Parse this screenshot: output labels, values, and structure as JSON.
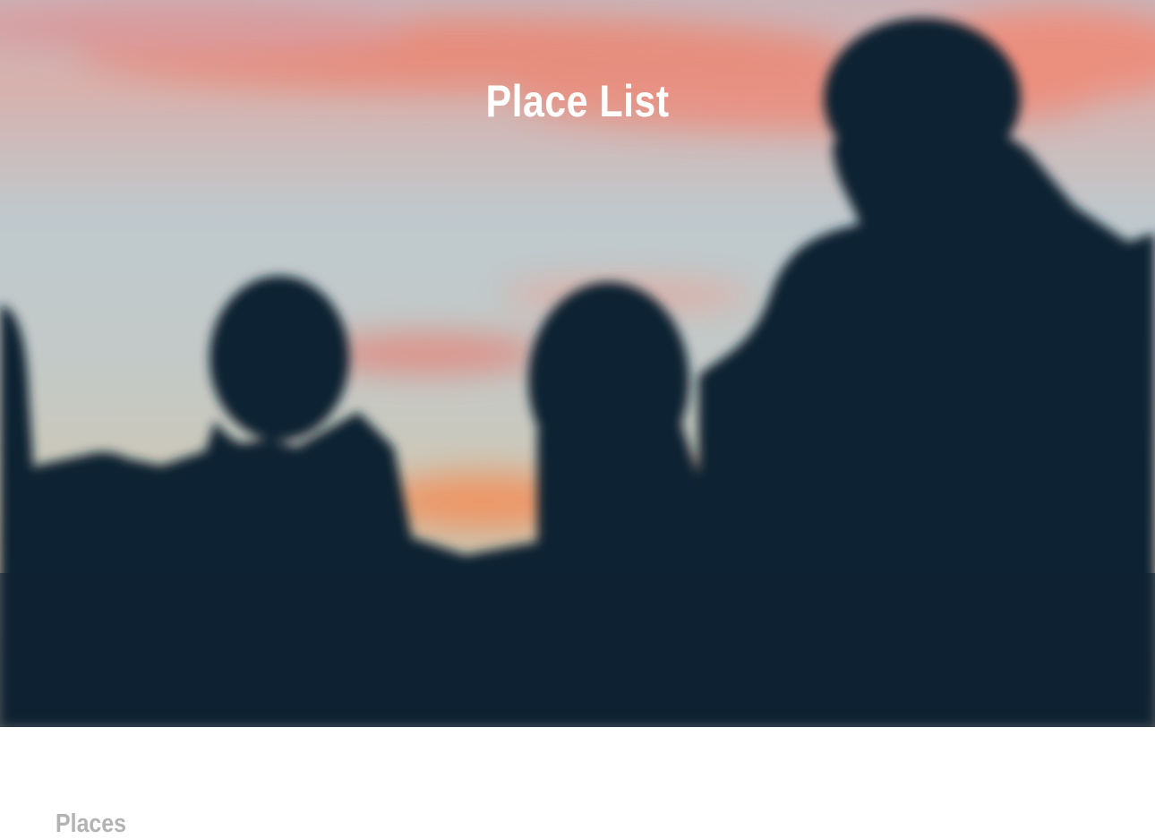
{
  "hero": {
    "title": "Place List",
    "image": "silhouettes-at-sunset-photo"
  },
  "places": {
    "heading": "Places"
  },
  "colors": {
    "hero_title": "#ffffff",
    "heading": "#b3b3b3",
    "silhouette": "#0f2232"
  }
}
